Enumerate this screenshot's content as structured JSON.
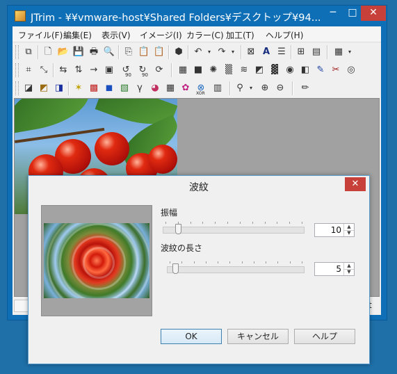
{
  "window": {
    "title": "JTrim - ¥¥vmware-host¥Shared Folders¥デスクトップ¥94...",
    "min_glyph": "─",
    "max_glyph": "□",
    "close_glyph": "✕"
  },
  "menu": [
    "ファイル(F)",
    "編集(E)",
    "表示(V)",
    "イメージ(I)",
    "カラー(C)",
    "加工(T)",
    "ヘルプ(H)"
  ],
  "toolbar": {
    "row1": [
      "paste-as-new-icon",
      "new-icon",
      "open-icon",
      "save-icon",
      "print-icon",
      "print-preview-icon",
      "copy-icon",
      "paste-icon",
      "paste-special-icon",
      "bucket-icon",
      "undo-icon",
      "redo-icon",
      "fit-icon",
      "text-icon",
      "sharpen-icon",
      "grid-icon",
      "film-icon",
      "tile-icon"
    ],
    "row1_glyphs": [
      "⧉",
      "🗋",
      "📂",
      "💾",
      "🖶",
      "🔍",
      "⎘",
      "📋",
      "📋",
      "⬢",
      "↶",
      "↷",
      "⊠",
      "A",
      "☰",
      "⊞",
      "▤",
      "▦"
    ],
    "row2_glyphs": [
      "⌗",
      "⤡",
      "⇆",
      "⇅",
      "→",
      "▣",
      "↺",
      "↻",
      "⟳",
      "▦",
      "■",
      "✺",
      "▒",
      "≋",
      "◩",
      "▓",
      "◉",
      "◧",
      "✎",
      "✂",
      "◎"
    ],
    "row3_glyphs": [
      "◪",
      "◩",
      "◨",
      "✶",
      "▩",
      "◼",
      "▧",
      "γ",
      "◕",
      "▦",
      "✿",
      "⊗",
      "▥",
      "⚲",
      "⊕",
      "⊖",
      "✏"
    ],
    "row3_text": {
      "g90a": "90",
      "g90b": "90",
      "xor": "XOR"
    }
  },
  "statusbar": {
    "right_text": "t"
  },
  "dialog": {
    "title": "波紋",
    "close_glyph": "✕",
    "amplitude": {
      "label": "振幅",
      "value": "10",
      "slider_fraction": 0.09
    },
    "wavelength": {
      "label": "波紋の長さ",
      "value": "5",
      "slider_fraction": 0.04
    },
    "spin_up_glyph": "▲",
    "spin_down_glyph": "▼",
    "buttons": {
      "ok": "OK",
      "cancel": "キャンセル",
      "help": "ヘルプ"
    }
  }
}
